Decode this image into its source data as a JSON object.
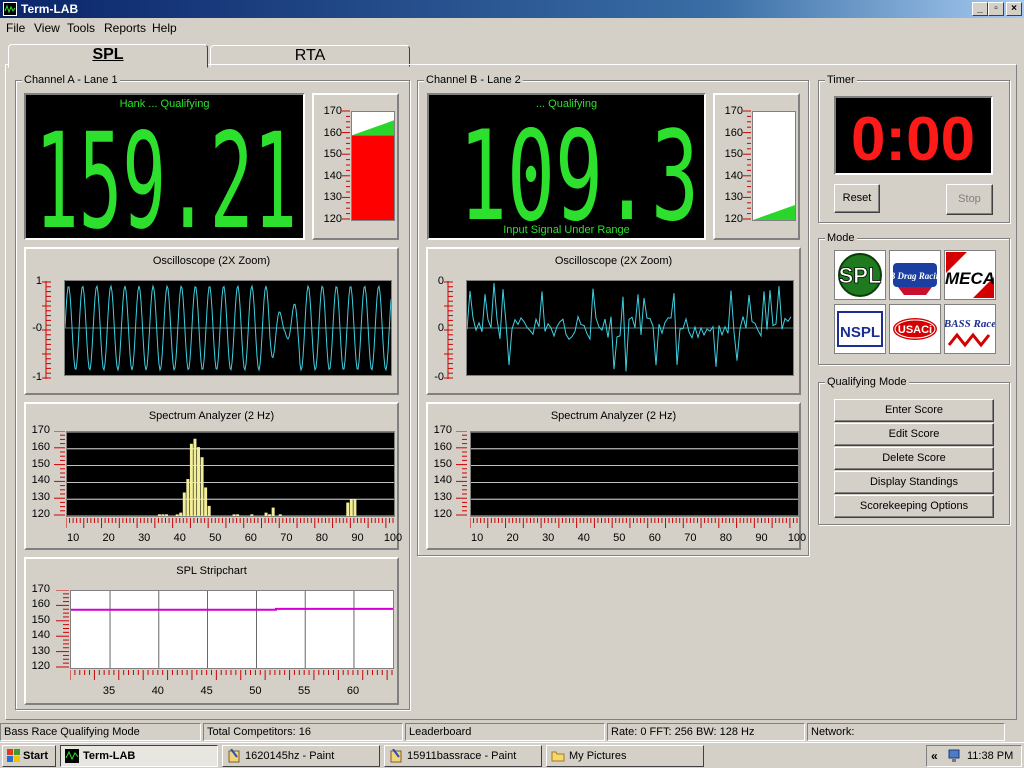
{
  "window": {
    "title": "Term-LAB"
  },
  "menu": [
    "File",
    "View",
    "Tools",
    "Reports",
    "Help"
  ],
  "tabs": [
    "SPL",
    "RTA"
  ],
  "channel_a": {
    "group_label": "Channel A - Lane 1",
    "display_label": "Hank ... Qualifying",
    "value": "159.21",
    "bar_scale": [
      "170",
      "160",
      "150",
      "140",
      "130",
      "120"
    ],
    "bar_fill_value": 159.21,
    "scope_title": "Oscilloscope (2X Zoom)",
    "scope_ticks": [
      "1",
      "-0",
      "-1"
    ],
    "spectrum_title": "Spectrum Analyzer (2 Hz)",
    "spectrum_y": [
      "170",
      "160",
      "150",
      "140",
      "130",
      "120"
    ],
    "spectrum_x": [
      "10",
      "20",
      "30",
      "40",
      "50",
      "60",
      "70",
      "80",
      "90",
      "100"
    ],
    "strip_title": "SPL Stripchart",
    "strip_y": [
      "170",
      "160",
      "150",
      "140",
      "130",
      "120"
    ],
    "strip_x": [
      "35",
      "40",
      "45",
      "50",
      "55",
      "60"
    ]
  },
  "channel_b": {
    "group_label": "Channel B - Lane 2",
    "display_label": "... Qualifying",
    "value": "109.3",
    "status": "Input Signal Under Range",
    "bar_scale": [
      "170",
      "160",
      "150",
      "140",
      "130",
      "120"
    ],
    "bar_fill_value": 120,
    "scope_title": "Oscilloscope (2X Zoom)",
    "scope_ticks": [
      "0",
      "0",
      "-0"
    ],
    "spectrum_title": "Spectrum Analyzer (2 Hz)",
    "spectrum_y": [
      "170",
      "160",
      "150",
      "140",
      "130",
      "120"
    ],
    "spectrum_x": [
      "10",
      "20",
      "30",
      "40",
      "50",
      "60",
      "70",
      "80",
      "90",
      "100"
    ]
  },
  "timer": {
    "group_label": "Timer",
    "value": "0:00",
    "reset_label": "Reset",
    "stop_label": "Stop"
  },
  "mode": {
    "group_label": "Mode",
    "logos": [
      "SPL",
      "dB Drag Racing",
      "MECA",
      "NSPL",
      "USACi",
      "BASS Race"
    ]
  },
  "qualifying_mode": {
    "group_label": "Qualifying Mode",
    "buttons": [
      "Enter Score",
      "Edit Score",
      "Delete Score",
      "Display Standings",
      "Scorekeeping Options"
    ]
  },
  "status_bar": [
    "Bass Race Qualifying Mode",
    "Total Competitors: 16",
    "Leaderboard",
    "Rate: 0 FFT: 256 BW: 128 Hz",
    "Network:"
  ],
  "taskbar": {
    "start": "Start",
    "items": [
      "Term-LAB",
      "1620145hz - Paint",
      "15911bassrace - Paint",
      "My Pictures"
    ],
    "tray_chevron": "«",
    "clock": "11:38 PM"
  },
  "colors": {
    "lcd_green": "#2de02d",
    "timer_red": "#ff1a1a",
    "bar_red": "#ff0000",
    "bar_green": "#2bd62b",
    "scope_cyan": "#3ed0e0",
    "spectrum_yellow": "#f2ee9a",
    "strip_magenta": "#d200d2"
  }
}
